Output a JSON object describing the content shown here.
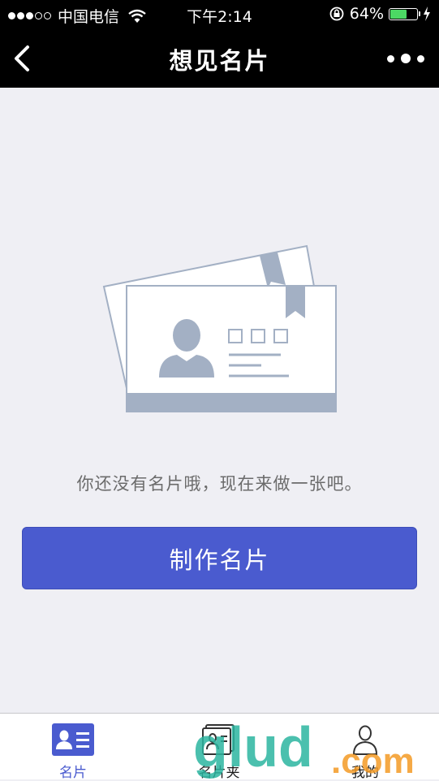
{
  "status_bar": {
    "carrier": "中国电信",
    "time": "下午2:14",
    "battery": "64%",
    "battery_level": 0.64
  },
  "nav": {
    "title": "想见名片"
  },
  "main": {
    "empty_message": "你还没有名片哦，现在来做一张吧。",
    "create_button_label": "制作名片"
  },
  "tabs": [
    {
      "label": "名片",
      "active": true
    },
    {
      "label": "名片夹",
      "active": false
    },
    {
      "label": "我的",
      "active": false
    }
  ],
  "colors": {
    "accent": "#4a5bcf",
    "card_gray": "#a3b0c4"
  },
  "watermark": {
    "text": "glud.com"
  }
}
